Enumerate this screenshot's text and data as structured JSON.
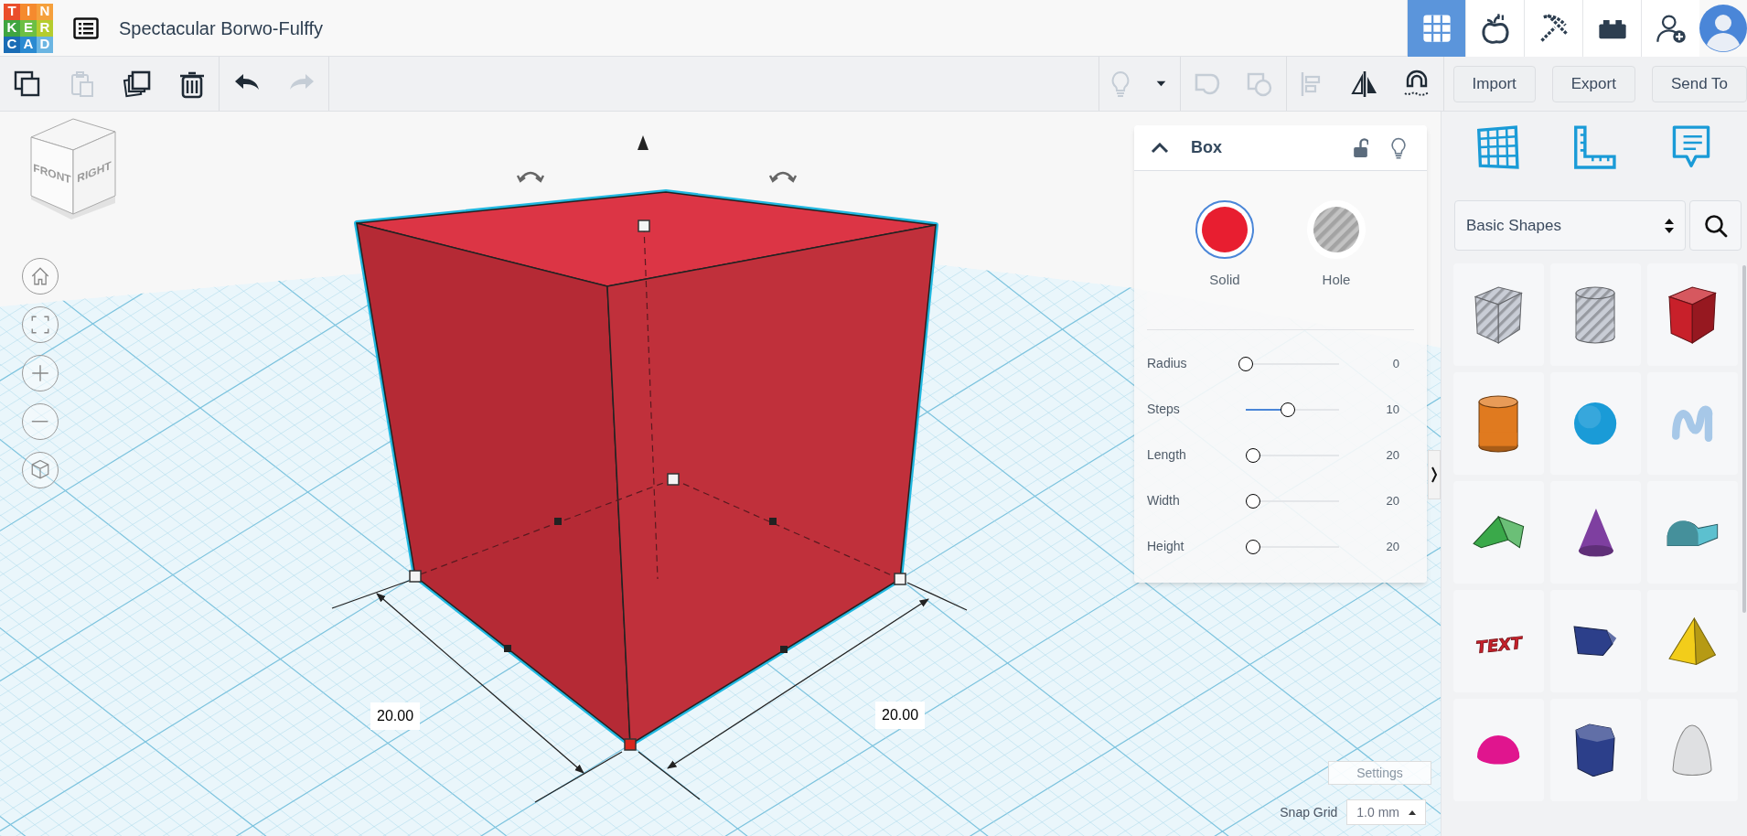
{
  "logo": [
    {
      "letter": "T",
      "color": "#ea4e2b"
    },
    {
      "letter": "I",
      "color": "#f58a2e"
    },
    {
      "letter": "N",
      "color": "#f5a03c"
    },
    {
      "letter": "K",
      "color": "#3fa540"
    },
    {
      "letter": "E",
      "color": "#6cbf44"
    },
    {
      "letter": "R",
      "color": "#b5cc2e"
    },
    {
      "letter": "C",
      "color": "#1a6cb5"
    },
    {
      "letter": "A",
      "color": "#2a8ad1"
    },
    {
      "letter": "D",
      "color": "#6bb5e2"
    }
  ],
  "title": "Spectacular Borwo-Fulffy",
  "view_buttons": [
    {
      "kind": "grid",
      "selected": true
    },
    {
      "kind": "apple",
      "selected": false
    },
    {
      "kind": "pickaxe",
      "selected": false
    },
    {
      "kind": "brick",
      "selected": false
    },
    {
      "kind": "add-user",
      "selected": false
    }
  ],
  "toolbar": {
    "left": [
      {
        "kind": "copy",
        "disabled": false
      },
      {
        "kind": "paste",
        "disabled": true
      },
      {
        "kind": "duplicate",
        "disabled": false
      },
      {
        "kind": "delete",
        "disabled": false
      },
      {
        "kind": "undo",
        "disabled": false
      },
      {
        "kind": "redo",
        "disabled": true
      }
    ],
    "right": [
      {
        "kind": "bulb",
        "disabled": true
      },
      {
        "kind": "dropdown",
        "disabled": false
      },
      {
        "kind": "group",
        "disabled": true
      },
      {
        "kind": "ungroup",
        "disabled": true
      },
      {
        "kind": "align",
        "disabled": true
      },
      {
        "kind": "mirror",
        "disabled": false
      },
      {
        "kind": "magnet",
        "disabled": false
      }
    ],
    "buttons": [
      "Import",
      "Export",
      "Send To"
    ]
  },
  "view_cube": {
    "faces": [
      "FRONT",
      "RIGHT"
    ]
  },
  "nav_buttons": [
    {
      "kind": "home"
    },
    {
      "kind": "fit"
    },
    {
      "kind": "zoom-in"
    },
    {
      "kind": "zoom-out"
    },
    {
      "kind": "perspective"
    }
  ],
  "dimension_labels": [
    "20.00",
    "20.00"
  ],
  "inspector": {
    "title": "Box",
    "expanded": true,
    "locked": false,
    "modes": [
      {
        "label": "Solid",
        "selected": true
      },
      {
        "label": "Hole",
        "selected": false
      }
    ],
    "params": [
      {
        "label": "Radius",
        "level": 0,
        "reading": "0"
      },
      {
        "label": "Steps",
        "level": 0.45,
        "reading": "10"
      },
      {
        "label": "Length",
        "level": 0.08,
        "reading": "20"
      },
      {
        "label": "Width",
        "level": 0.08,
        "reading": "20"
      },
      {
        "label": "Height",
        "level": 0.08,
        "reading": "20"
      }
    ]
  },
  "settings_button": "Settings",
  "snap_grid": {
    "label": "Snap Grid",
    "value": "1.0 mm"
  },
  "sidebar": {
    "tools": [
      {
        "kind": "workplane"
      },
      {
        "kind": "ruler"
      },
      {
        "kind": "notes"
      }
    ],
    "category": "Basic Shapes",
    "shapes": [
      {
        "kind": "box-hole",
        "color": "#c9cdd6"
      },
      {
        "kind": "cylinder-hole",
        "color": "#c9cdd6"
      },
      {
        "kind": "box",
        "color": "#c8202a"
      },
      {
        "kind": "cylinder",
        "color": "#e07a1f"
      },
      {
        "kind": "sphere",
        "color": "#1a9bd7"
      },
      {
        "kind": "scribble",
        "color": "#a7c8e8"
      },
      {
        "kind": "roof",
        "color": "#3aa94a"
      },
      {
        "kind": "cone",
        "color": "#7e3fa0"
      },
      {
        "kind": "round-roof",
        "color": "#5cc0cf"
      },
      {
        "kind": "text",
        "color": "#c8202a",
        "label": "TEXT"
      },
      {
        "kind": "wedge",
        "color": "#2c3f8a"
      },
      {
        "kind": "pyramid",
        "color": "#f2cd1a"
      },
      {
        "kind": "half-sphere",
        "color": "#e0158e"
      },
      {
        "kind": "polygon",
        "color": "#2c3f8a"
      },
      {
        "kind": "paraboloid",
        "color": "#dfe0e2"
      }
    ]
  }
}
